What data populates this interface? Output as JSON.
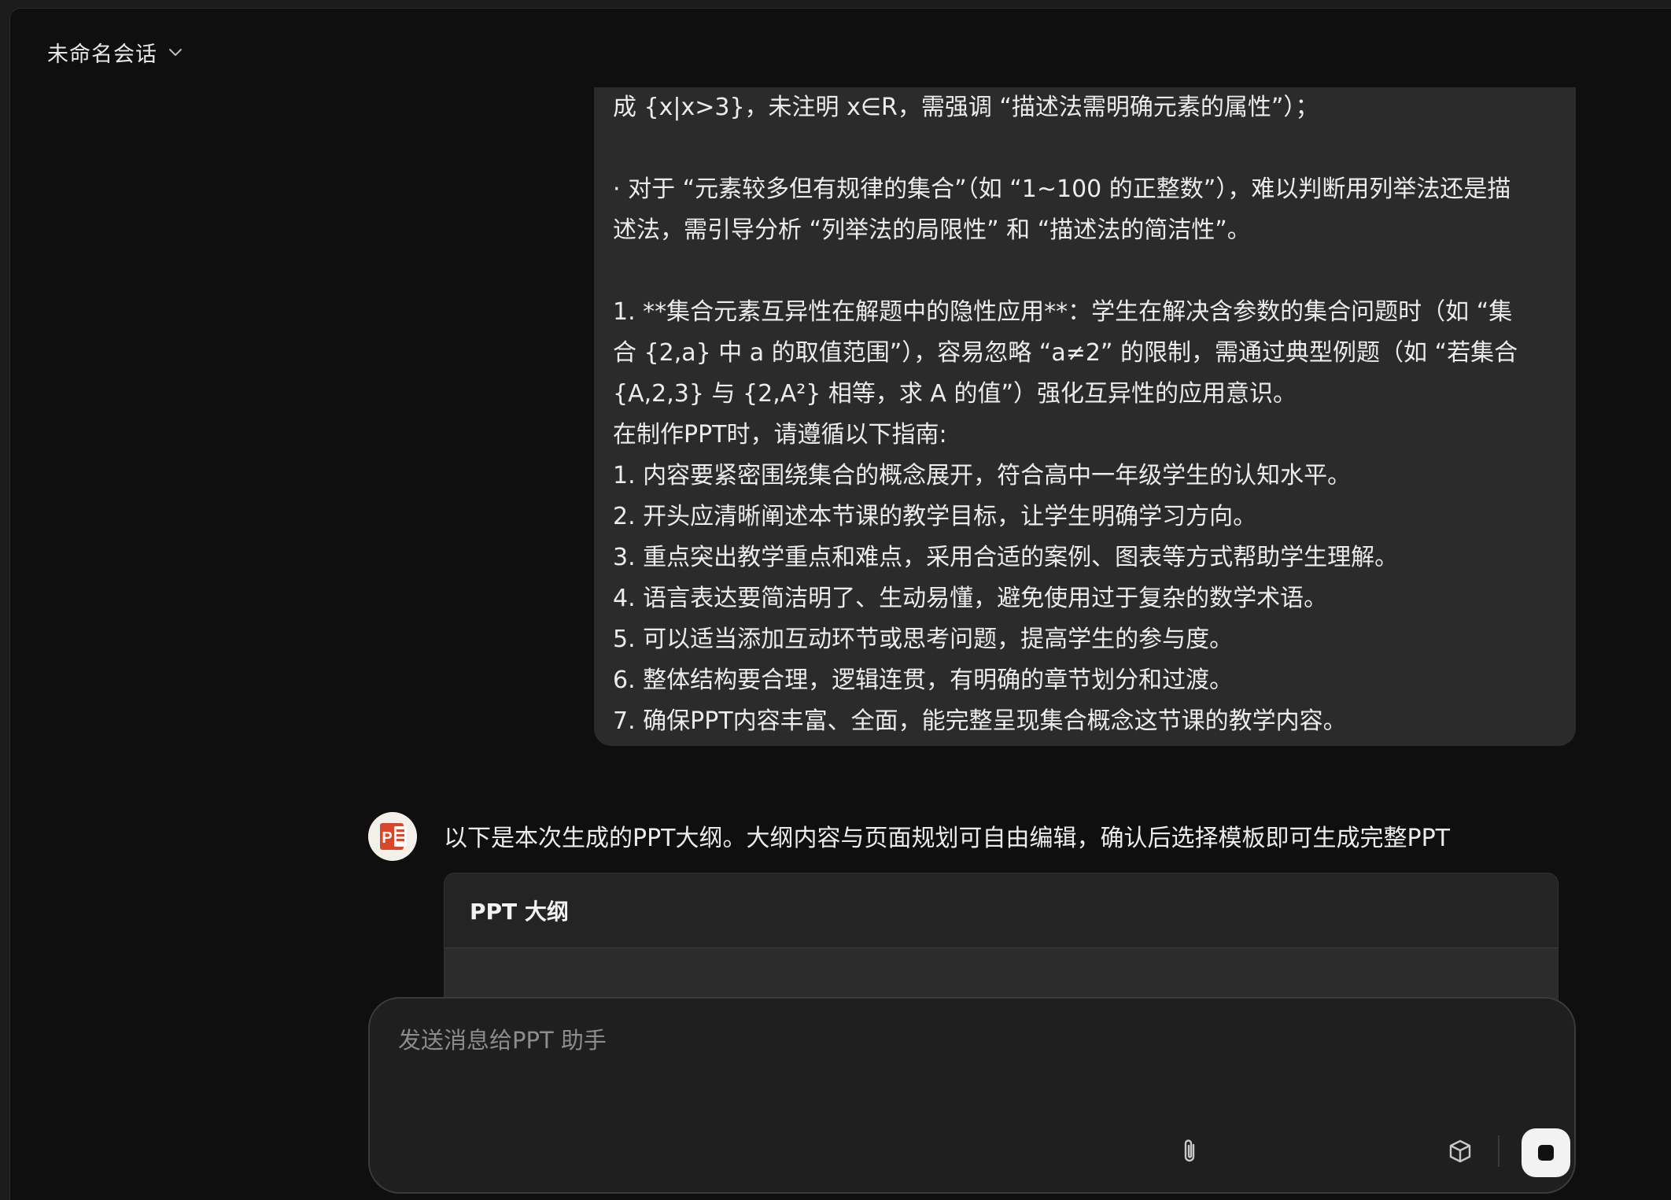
{
  "header": {
    "session_title": "未命名会话"
  },
  "user_message": {
    "lines": [
      "成 {x|x>3}，未注明 x∈R，需强调 “描述法需明确元素的属性”）；",
      "",
      "· 对于 “元素较多但有规律的集合”（如 “1~100 的正整数”），难以判断用列举法还是描",
      "述法，需引导分析 “列举法的局限性” 和 “描述法的简洁性”。",
      "",
      "1. **集合元素互异性在解题中的隐性应用**：学生在解决含参数的集合问题时（如 “集",
      "合 {2,a} 中 a 的取值范围”），容易忽略 “a≠2” 的限制，需通过典型例题（如 “若集合",
      "{A,2,3} 与 {2,A²} 相等，求 A 的值”）强化互异性的应用意识。",
      "在制作PPT时，请遵循以下指南:",
      "1. 内容要紧密围绕集合的概念展开，符合高中一年级学生的认知水平。",
      "2. 开头应清晰阐述本节课的教学目标，让学生明确学习方向。",
      "3. 重点突出教学重点和难点，采用合适的案例、图表等方式帮助学生理解。",
      "4. 语言表达要简洁明了、生动易懂，避免使用过于复杂的数学术语。",
      "5. 可以适当添加互动环节或思考问题，提高学生的参与度。",
      "6. 整体结构要合理，逻辑连贯，有明确的章节划分和过渡。",
      "7. 确保PPT内容丰富、全面，能完整呈现集合概念这节课的教学内容。"
    ]
  },
  "assistant": {
    "avatar_icon": "powerpoint-icon",
    "message": "以下是本次生成的PPT大纲。大纲内容与页面规划可自由编辑，确认后选择模板即可生成完整PPT",
    "outline_card_title": "PPT 大纲"
  },
  "composer": {
    "placeholder": "发送消息给PPT 助手",
    "value": "",
    "attach_icon": "paperclip-icon",
    "plugin_icon": "cube-icon",
    "stop_icon": "stop-icon"
  },
  "colors": {
    "background": "#0f0f0f",
    "bubble": "#2b2b2b",
    "accent_ppt": "#d9472b"
  }
}
